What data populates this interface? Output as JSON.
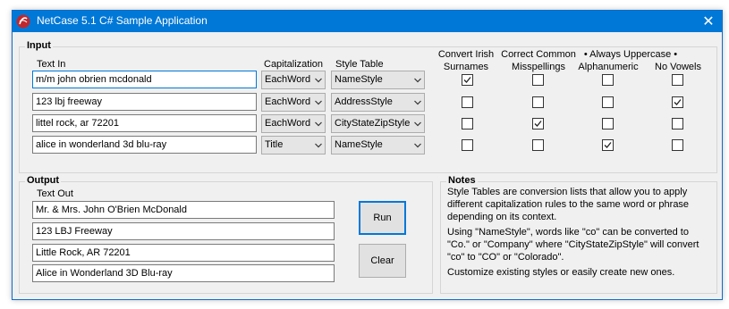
{
  "window": {
    "title": "NetCase 5.1 C# Sample Application",
    "close_glyph": "✕",
    "accent": "#0078d7"
  },
  "input": {
    "legend": "Input",
    "headers": {
      "text_in": "Text In",
      "capitalization": "Capitalization",
      "style_table": "Style Table",
      "irish": "Convert Irish",
      "irish2": "Surnames",
      "common": "Correct Common",
      "common2": "Misspellings",
      "always": "• Always Uppercase •",
      "alnum": "Alphanumeric",
      "novowels": "No Vowels"
    },
    "rows": [
      {
        "text": "m/m john obrien mcdonald",
        "cap": "EachWord",
        "style": "NameStyle",
        "irish": true,
        "common": false,
        "alnum": false,
        "novowels": false
      },
      {
        "text": "123 lbj freeway",
        "cap": "EachWord",
        "style": "AddressStyle",
        "irish": false,
        "common": false,
        "alnum": false,
        "novowels": true
      },
      {
        "text": "littel rock, ar 72201",
        "cap": "EachWord",
        "style": "CityStateZipStyle",
        "irish": false,
        "common": true,
        "alnum": false,
        "novowels": false
      },
      {
        "text": "alice in wonderland 3d blu-ray",
        "cap": "Title",
        "style": "NameStyle",
        "irish": false,
        "common": false,
        "alnum": true,
        "novowels": false
      }
    ]
  },
  "output": {
    "legend": "Output",
    "label": "Text Out",
    "rows": [
      "Mr. & Mrs. John O'Brien McDonald",
      "123 LBJ Freeway",
      "Little Rock, AR 72201",
      "Alice in Wonderland 3D Blu-ray"
    ],
    "run": "Run",
    "clear": "Clear"
  },
  "notes": {
    "legend": "Notes",
    "p1": "Style Tables are conversion lists that allow you to apply different capitalization rules to the same word or phrase depending on its context.",
    "p2": "Using \"NameStyle\", words like \"co\" can be converted to \"Co.\" or \"Company\" where \"CityStateZipStyle\" will convert \"co\" to \"CO\" or \"Colorado\".",
    "p3": "Customize existing styles or easily create new ones."
  }
}
